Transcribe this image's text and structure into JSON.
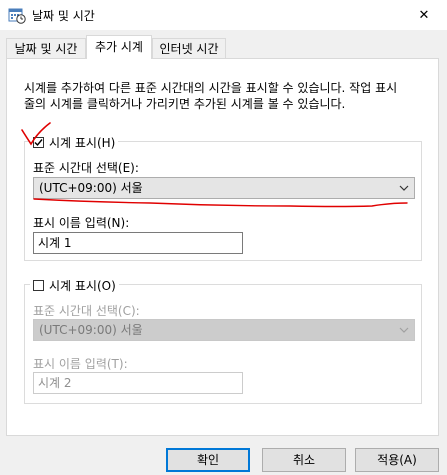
{
  "window": {
    "title": "날짜 및 시간",
    "icon": "calendar-clock-icon",
    "close_glyph": "✕"
  },
  "tabs": [
    {
      "label": "날짜 및 시간",
      "active": false
    },
    {
      "label": "추가 시계",
      "active": true
    },
    {
      "label": "인터넷 시간",
      "active": false
    }
  ],
  "description_line1": "시계를 추가하여 다른 표준 시간대의 시간을 표시할 수 있습니다. 작업 표시",
  "description_line2": "줄의 시계를 클릭하거나 가리키면 추가된 시계를 볼 수 있습니다.",
  "clock1": {
    "show_label": "시계 표시(H)",
    "checked": true,
    "timezone_label": "표준 시간대 선택(E):",
    "timezone_value": "(UTC+09:00) 서울",
    "name_label": "표시 이름 입력(N):",
    "name_value": "시계 1",
    "enabled": true
  },
  "clock2": {
    "show_label": "시계 표시(O)",
    "checked": false,
    "timezone_label": "표준 시간대 선택(C):",
    "timezone_value": "(UTC+09:00) 서울",
    "name_label": "표시 이름 입력(T):",
    "name_value": "시계 2",
    "enabled": false
  },
  "buttons": {
    "ok": "확인",
    "cancel": "취소",
    "apply": "적용(A)"
  },
  "colors": {
    "annotation_red": "#e00000",
    "focus_blue": "#0078d7"
  }
}
